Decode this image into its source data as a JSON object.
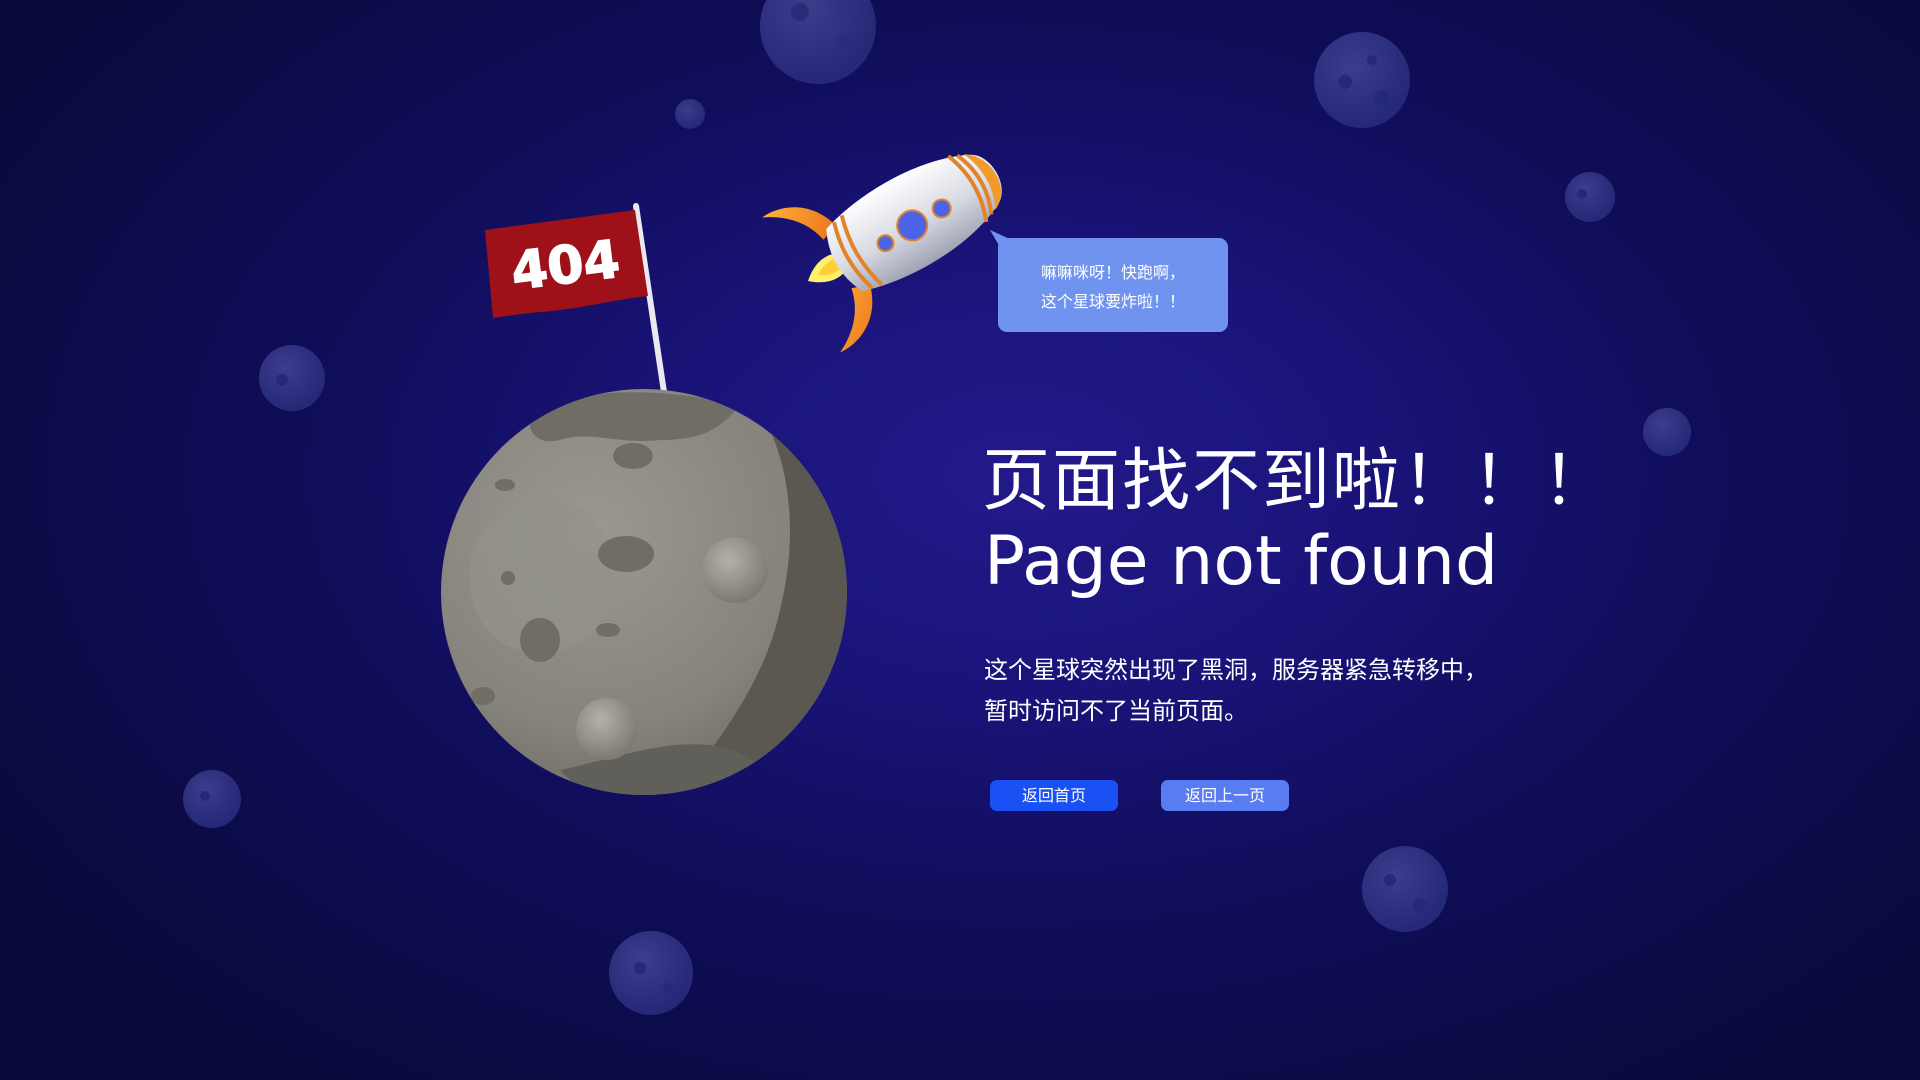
{
  "flag": {
    "text": "404"
  },
  "bubble": {
    "line1": "嘛嘛咪呀！快跑啊，",
    "line2": "这个星球要炸啦！！"
  },
  "headline": {
    "zh": "页面找不到啦！！！",
    "en": "Page not found"
  },
  "description": {
    "line1": "这个星球突然出现了黑洞，服务器紧急转移中，",
    "line2": "暂时访问不了当前页面。"
  },
  "buttons": {
    "home_label": "返回首页",
    "back_label": "返回上一页"
  },
  "colors": {
    "background": "#100d5a",
    "bubble": "#6f93ef",
    "home_button": "#1951f5",
    "back_button": "#5a7cf2",
    "flag": "#9e1118"
  },
  "icons": {
    "planet": "moon-planet-icon",
    "flag": "flag-404-icon",
    "rocket": "rocket-icon"
  }
}
